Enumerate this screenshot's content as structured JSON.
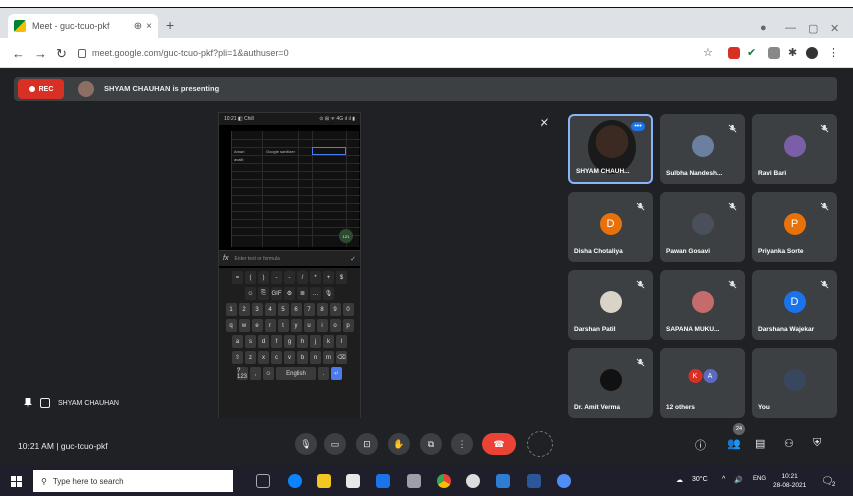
{
  "browser": {
    "tab_title": "Meet - guc-tcuo-pkf",
    "tab_close": "×",
    "tab_extra": "⊕",
    "new_tab": "+",
    "url": "meet.google.com/guc-tcuo-pkf?pli=1&authuser=0"
  },
  "presentation": {
    "rec_label": "REC",
    "presenter_text": "SHYAM CHAUHAN is presenting"
  },
  "phone": {
    "status_left": "10:21 ◧ Chill",
    "status_right": "⊙ ⊞ ᯤ 4G ıl ıl ▮",
    "cell_a": "Aman",
    "cell_b": "Google sanitizer",
    "cell_c": "avaiti",
    "counter": "121",
    "formula_placeholder": "Enter text or formula",
    "symbol_row": [
      "=",
      "(",
      ")",
      "-",
      "-",
      "/",
      "*",
      "+",
      "$"
    ],
    "tool_row": [
      "☺",
      "⎘",
      "GIF",
      "⚙",
      "≣",
      "…",
      "🎙"
    ],
    "number_row": [
      "1",
      "2",
      "3",
      "4",
      "5",
      "6",
      "7",
      "8",
      "9",
      "0"
    ],
    "row_q": [
      "q",
      "w",
      "e",
      "r",
      "t",
      "y",
      "u",
      "i",
      "o",
      "p"
    ],
    "row_a": [
      "a",
      "s",
      "d",
      "f",
      "g",
      "h",
      "j",
      "k",
      "l"
    ],
    "row_z": [
      "⇧",
      "z",
      "x",
      "c",
      "v",
      "b",
      "n",
      "m",
      "⌫"
    ],
    "bottom_row": [
      "?123",
      ",",
      "☺",
      "English",
      ".",
      "↵"
    ]
  },
  "main_speaker": "SHYAM CHAUHAN",
  "tiles": [
    {
      "name": "SHYAM CHAUH...",
      "kind": "video"
    },
    {
      "name": "Sulbha Nandesh...",
      "kind": "photo",
      "color": "#6b7fa0"
    },
    {
      "name": "Ravi Bari",
      "kind": "photo",
      "color": "#7a5fa8"
    },
    {
      "name": "Disha Chotaliya",
      "kind": "letter",
      "letter": "D",
      "color": "#e8710a"
    },
    {
      "name": "Pawan Gosavi",
      "kind": "photo",
      "color": "#4a4f5c"
    },
    {
      "name": "Priyanka Sorte",
      "kind": "letter",
      "letter": "P",
      "color": "#e8710a"
    },
    {
      "name": "Darshan Patil",
      "kind": "photo",
      "color": "#d9d4c7"
    },
    {
      "name": "SAPANA MUKU...",
      "kind": "photo",
      "color": "#c56b6b"
    },
    {
      "name": "Darshana Wajekar",
      "kind": "letter",
      "letter": "D",
      "color": "#1a73e8"
    },
    {
      "name": "Dr. Amit Verma",
      "kind": "photo",
      "color": "#111111"
    },
    {
      "name": "12 others",
      "kind": "others",
      "letters": [
        "K",
        "A"
      ]
    },
    {
      "name": "You",
      "kind": "photo",
      "color": "#39475e"
    }
  ],
  "bottom": {
    "time_and_code": "10:21 AM  |  guc-tcuo-pkf",
    "people_count": "24"
  },
  "taskbar": {
    "search_placeholder": "Type here to search",
    "weather": "30°C",
    "lang": "ENG",
    "time": "10:21",
    "date": "28-08-2021",
    "notif_count": "2"
  },
  "colors": {
    "meet_bg": "#202124",
    "tile_bg": "#3c4043",
    "rec_red": "#d93025",
    "end_call_red": "#ea4335",
    "active_border": "#8ab4f8"
  }
}
